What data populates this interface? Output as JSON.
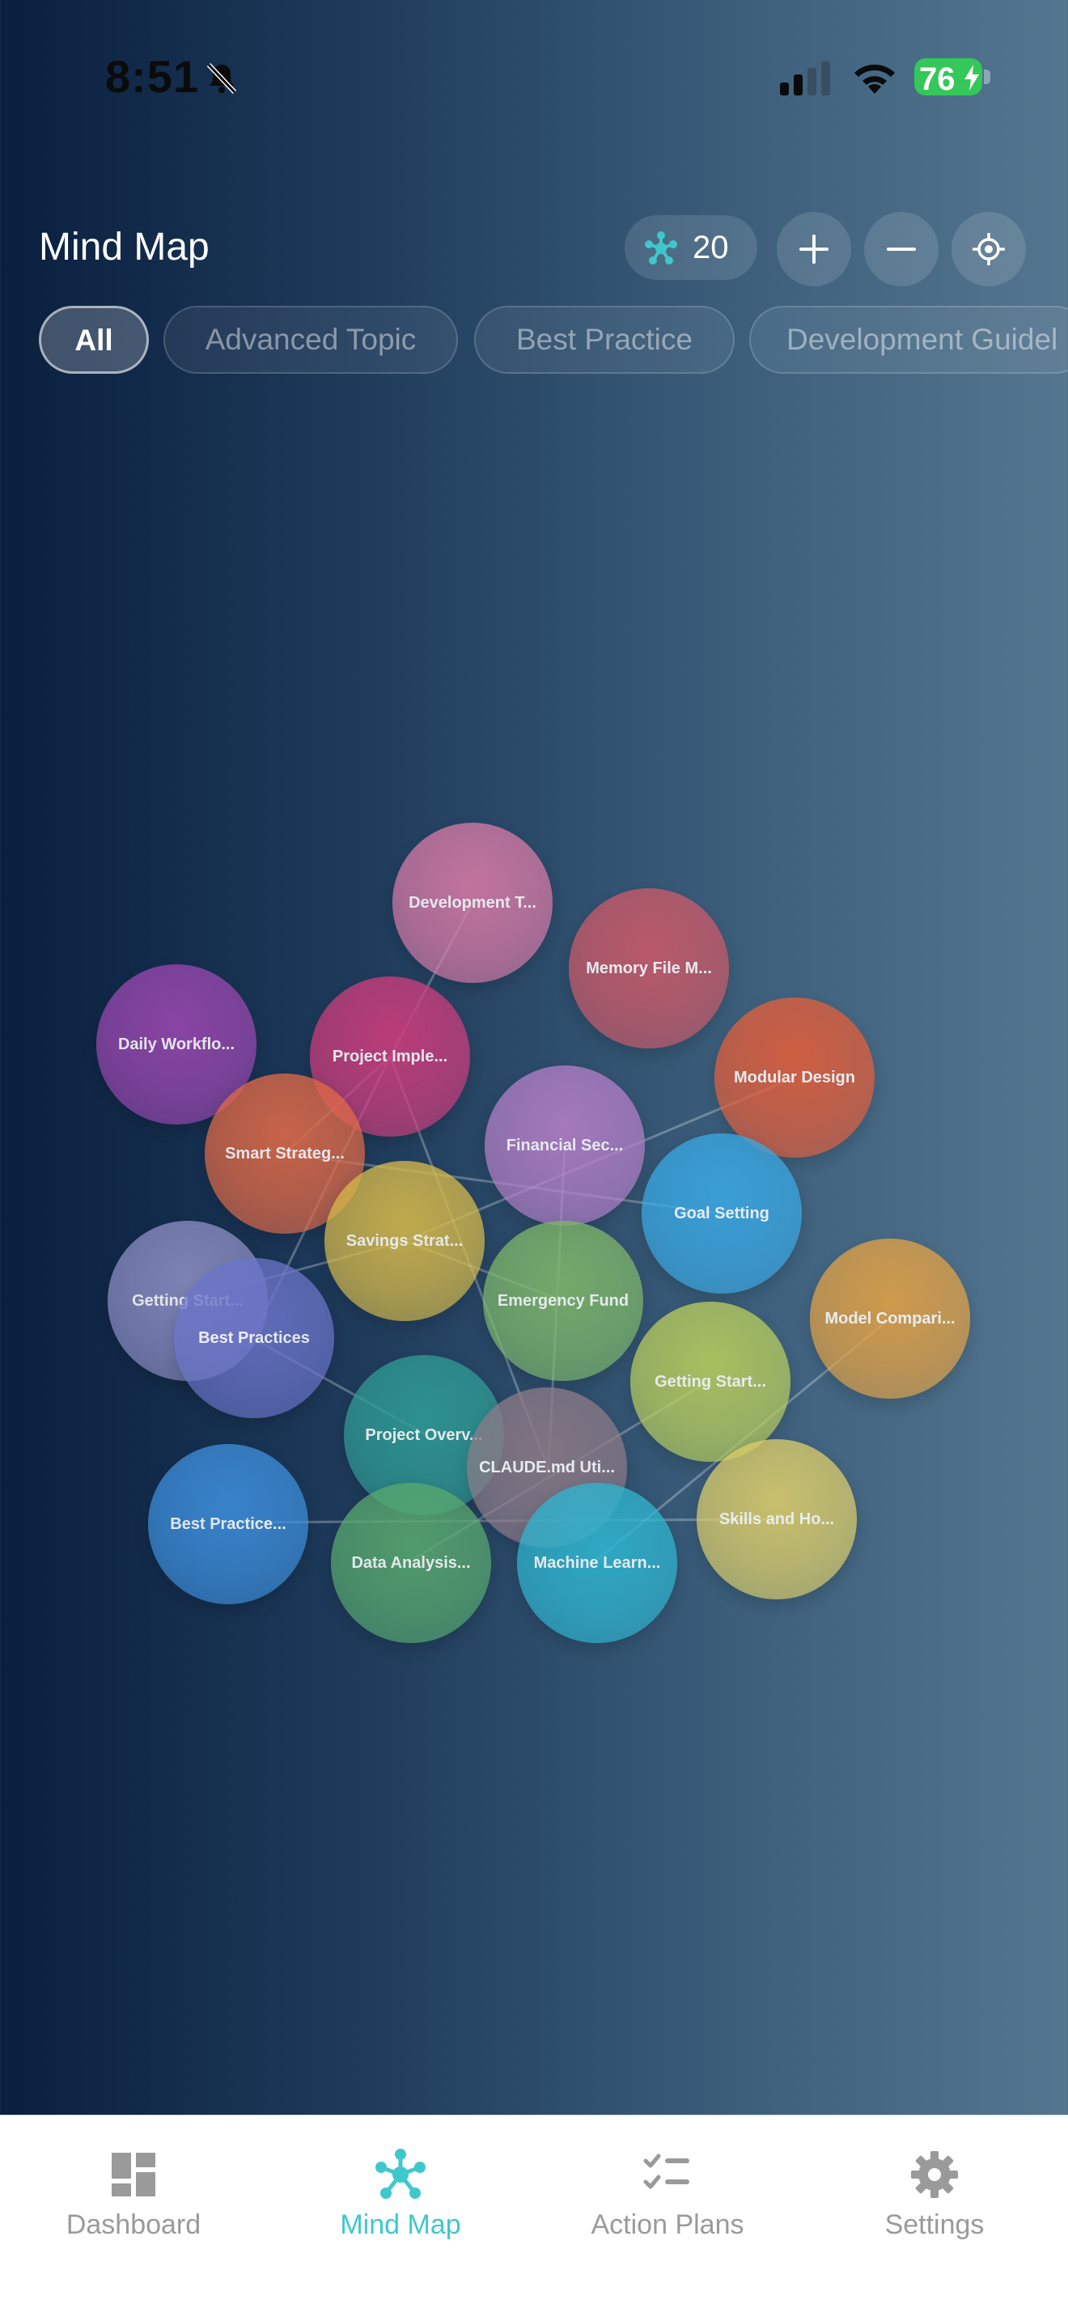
{
  "status_bar": {
    "time": "8:51",
    "battery": "76"
  },
  "header": {
    "title": "Mind Map",
    "node_count": "20"
  },
  "filters": [
    "All",
    "Advanced Topic",
    "Best Practice",
    "Development Guidel"
  ],
  "active_filter": "All",
  "mind_map": {
    "nodes": [
      {
        "label": "Development T...",
        "color": "#d77aa6"
      },
      {
        "label": "Memory File M...",
        "color": "#cc5a68"
      },
      {
        "label": "Daily Workflo...",
        "color": "#9a48b0"
      },
      {
        "label": "Project Imple...",
        "color": "#cf3d7d"
      },
      {
        "label": "Modular Design",
        "color": "#e25e3a"
      },
      {
        "label": "Smart Strateg...",
        "color": "#e06a47"
      },
      {
        "label": "Financial Sec...",
        "color": "#b47fc7"
      },
      {
        "label": "Goal Setting",
        "color": "#3aa8e3"
      },
      {
        "label": "Savings Strat...",
        "color": "#d6b94a"
      },
      {
        "label": "Emergency Fund",
        "color": "#7eb66a"
      },
      {
        "label": "Model Compari...",
        "color": "#e2a144"
      },
      {
        "label": "Getting Start...",
        "color": "#8d8fc4"
      },
      {
        "label": "Best Practices",
        "color": "#6a74c8"
      },
      {
        "label": "Getting Start...",
        "color": "#b8cd5c"
      },
      {
        "label": "Project Overv...",
        "color": "#2f9c95"
      },
      {
        "label": "CLAUDE.md Uti...",
        "color": "#8c7a86"
      },
      {
        "label": "Best Practice...",
        "color": "#3d8fdc"
      },
      {
        "label": "Skills and Ho...",
        "color": "#dccd6a"
      },
      {
        "label": "Data Analysis...",
        "color": "#58a86e"
      },
      {
        "label": "Machine Learn...",
        "color": "#2fb5d0"
      }
    ]
  },
  "tab_bar": {
    "tabs": [
      {
        "label": "Dashboard",
        "icon": "dashboard-icon"
      },
      {
        "label": "Mind Map",
        "icon": "mind-map-icon"
      },
      {
        "label": "Action Plans",
        "icon": "checklist-icon"
      },
      {
        "label": "Settings",
        "icon": "gear-icon"
      }
    ],
    "active": "Mind Map",
    "accent": "#3fc8cc"
  }
}
